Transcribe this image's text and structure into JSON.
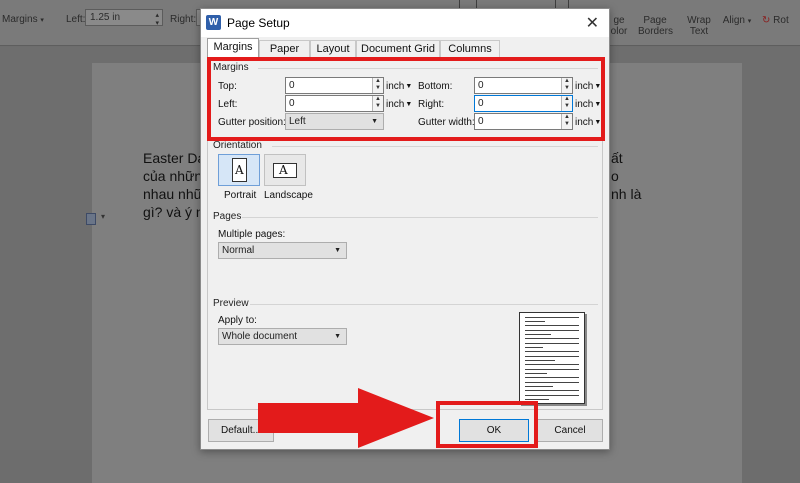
{
  "ribbon": {
    "margins_label": "Margins",
    "left_label": "Left:",
    "left_value": "1.25 in",
    "right_label": "Right:",
    "page_color_label": "ge\nolor",
    "page_borders_label": "Page\nBorders",
    "wrap_text_label": "Wrap\nText",
    "align_label": "Align",
    "rotate_label": "Rot"
  },
  "document": {
    "lines": [
      "Easter Da",
      "của nhữn",
      "nhau nhữ",
      "gì? và ý n"
    ],
    "right_fragments": [
      "ất",
      "o",
      "nh là"
    ]
  },
  "dialog": {
    "title": "Page Setup",
    "tabs": [
      {
        "label": "Margins",
        "active": true
      },
      {
        "label": "Paper",
        "active": false
      },
      {
        "label": "Layout",
        "active": false
      },
      {
        "label": "Document Grid",
        "active": false
      },
      {
        "label": "Columns",
        "active": false
      }
    ],
    "margins": {
      "section": "Margins",
      "top_label": "Top:",
      "top_value": "0",
      "bottom_label": "Bottom:",
      "bottom_value": "0",
      "left_label": "Left:",
      "left_value": "0",
      "right_label": "Right:",
      "right_value": "0",
      "gutter_pos_label": "Gutter position:",
      "gutter_pos_value": "Left",
      "gutter_width_label": "Gutter width:",
      "gutter_width_value": "0",
      "unit": "inch"
    },
    "orientation": {
      "section": "Orientation",
      "portrait_label": "Portrait",
      "landscape_label": "Landscape",
      "selected": "Portrait"
    },
    "pages": {
      "section": "Pages",
      "multiple_label": "Multiple pages:",
      "multiple_value": "Normal"
    },
    "preview": {
      "section": "Preview",
      "apply_label": "Apply to:",
      "apply_value": "Whole document"
    },
    "buttons": {
      "default_label": "Default...",
      "ok_label": "OK",
      "cancel_label": "Cancel"
    }
  },
  "colors": {
    "annotation": "#e31b1b",
    "focus_border": "#0078d7",
    "selected_orientation": "#d6e6f7"
  },
  "icons": [
    "app-logo-icon",
    "close-icon",
    "portrait-page-icon",
    "landscape-page-icon",
    "dropdown-arrow-icon",
    "spin-up-icon",
    "spin-down-icon"
  ]
}
